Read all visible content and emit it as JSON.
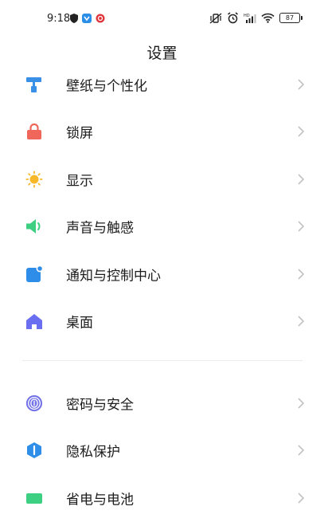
{
  "status_bar": {
    "time": "9:18",
    "battery": "87"
  },
  "header": {
    "title": "设置"
  },
  "group1": [
    {
      "label": "壁纸与个性化",
      "icon": "paint-roller-icon",
      "color": "#3a8fe6"
    },
    {
      "label": "锁屏",
      "icon": "lock-icon",
      "color": "#f0665a"
    },
    {
      "label": "显示",
      "icon": "sun-icon",
      "color": "#f7b929"
    },
    {
      "label": "声音与触感",
      "icon": "speaker-icon",
      "color": "#3dcf82"
    },
    {
      "label": "通知与控制中心",
      "icon": "notification-icon",
      "color": "#2e8de8"
    },
    {
      "label": "桌面",
      "icon": "home-icon",
      "color": "#6a6ef0"
    }
  ],
  "group2": [
    {
      "label": "密码与安全",
      "icon": "fingerprint-icon",
      "color": "#7474e8"
    },
    {
      "label": "隐私保护",
      "icon": "privacy-shield-icon",
      "color": "#2f8fe8"
    },
    {
      "label": "省电与电池",
      "icon": "battery-icon",
      "color": "#3dcf82"
    }
  ]
}
